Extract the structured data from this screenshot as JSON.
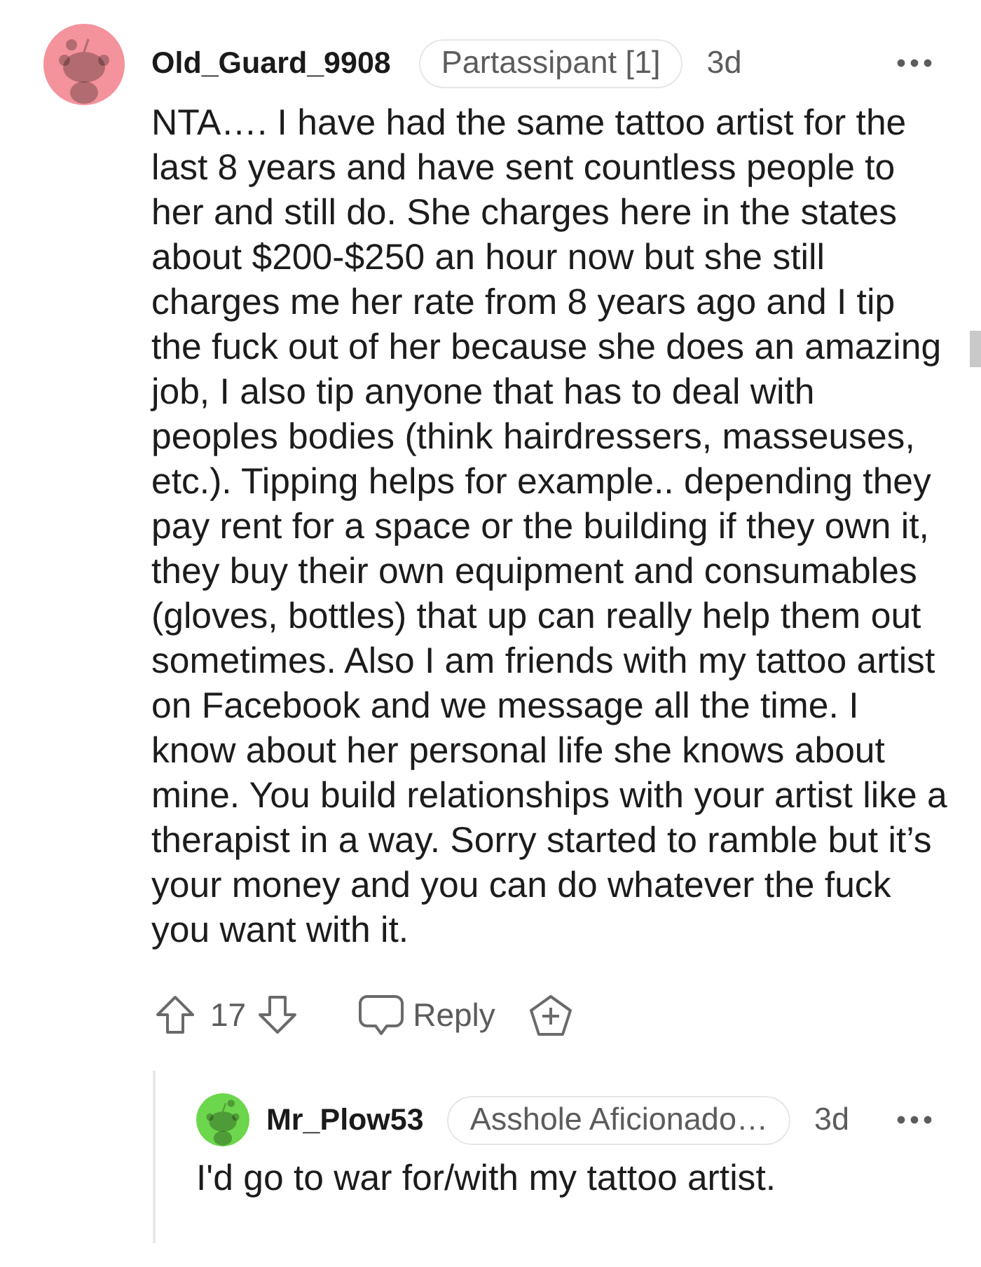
{
  "comments": [
    {
      "author": "Old_Guard_9908",
      "color": "#f4939c",
      "flair": "Partassipant [1]",
      "age": "3d",
      "body": "NTA…. I have had the same tattoo artist for the last 8 years and have sent countless people to her and still do. She charges here in the states about $200-$250 an hour now but she still charges me her rate from 8 years ago and I tip the fuck out of her because she does an amazing job, I also tip anyone that has to deal with peoples bodies (think hairdressers, masseuses, etc.). Tipping helps for example.. depending they pay rent for a space or the building if they own it, they buy their own equipment and consumables (gloves, bottles) that up can really help them out sometimes. Also I am friends with my tattoo artist on Facebook and we message all the time. I know about her personal life she knows about mine. You build relationships with your artist like a therapist in a way. Sorry started to ramble but it’s your money and you can do whatever the fuck you want with it.",
      "score": "17",
      "reply_label": "Reply",
      "children": [
        {
          "author": "Mr_Plow53",
          "color": "#6cd64c",
          "flair": "Asshole Aficionado…",
          "age": "3d",
          "body": "I'd go to war for/with my tattoo artist."
        }
      ]
    }
  ]
}
